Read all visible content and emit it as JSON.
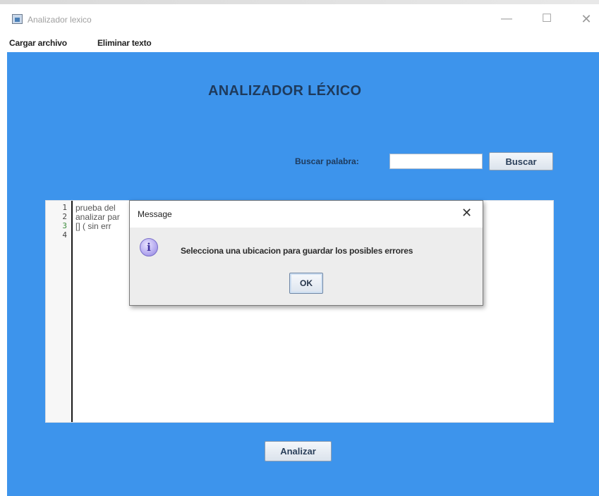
{
  "window": {
    "title": "Analizador lexico",
    "minimize_glyph": "—",
    "maximize_glyph": "☐",
    "close_glyph": "✕"
  },
  "menu": {
    "items": [
      {
        "label": "Cargar archivo"
      },
      {
        "label": "Eliminar texto"
      }
    ]
  },
  "main": {
    "title": "ANALIZADOR LÉXICO",
    "search": {
      "label": "Buscar palabra:",
      "value": "",
      "button_label": "Buscar"
    },
    "editor": {
      "lines": [
        {
          "number": "1",
          "text": "prueba del"
        },
        {
          "number": "2",
          "text": "analizar par"
        },
        {
          "number": "3",
          "text": "[] ( sin err"
        },
        {
          "number": "4",
          "text": ""
        }
      ]
    },
    "analyze_button_label": "Analizar",
    "background_color": "#3d94ec"
  },
  "dialog": {
    "title": "Message",
    "close_glyph": "✕",
    "icon": "info-icon",
    "icon_glyph": "i",
    "message": "Selecciona una ubicacion para guardar los posibles errores",
    "ok_label": "OK"
  }
}
